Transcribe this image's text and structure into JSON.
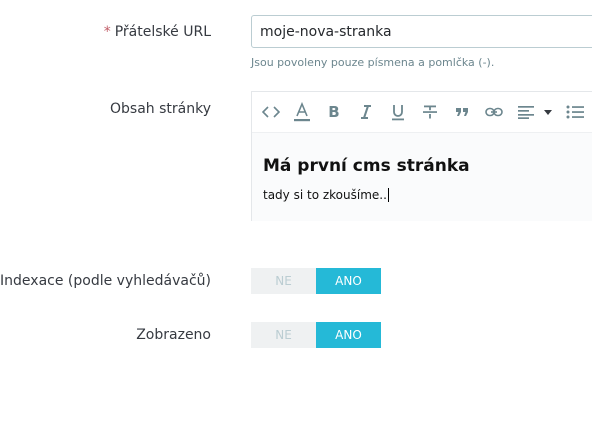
{
  "friendly_url": {
    "required_mark": "*",
    "label": "Přátelské URL",
    "value": "moje-nova-stranka",
    "hint": "Jsou povoleny pouze písmena a pomlčka (-)."
  },
  "content": {
    "label": "Obsah stránky",
    "toolbar": [
      "code-view-icon",
      "text-color-icon",
      "bold-icon",
      "italic-icon",
      "underline-icon",
      "strikethrough-icon",
      "blockquote-icon",
      "link-icon",
      "align-icon",
      "dropdown-caret-icon",
      "bulleted-list-icon"
    ],
    "heading": "Má první cms stránka",
    "paragraph": "tady si to zkoušíme.."
  },
  "indexation": {
    "label": "Indexace (podle vyhledávačů)",
    "off_label": "NE",
    "on_label": "ANO",
    "selected": "ANO"
  },
  "displayed": {
    "label": "Zobrazeno",
    "off_label": "NE",
    "on_label": "ANO",
    "selected": "ANO"
  },
  "colors": {
    "accent": "#25b9d7",
    "required": "#c05c67",
    "hint": "#6c868e"
  }
}
